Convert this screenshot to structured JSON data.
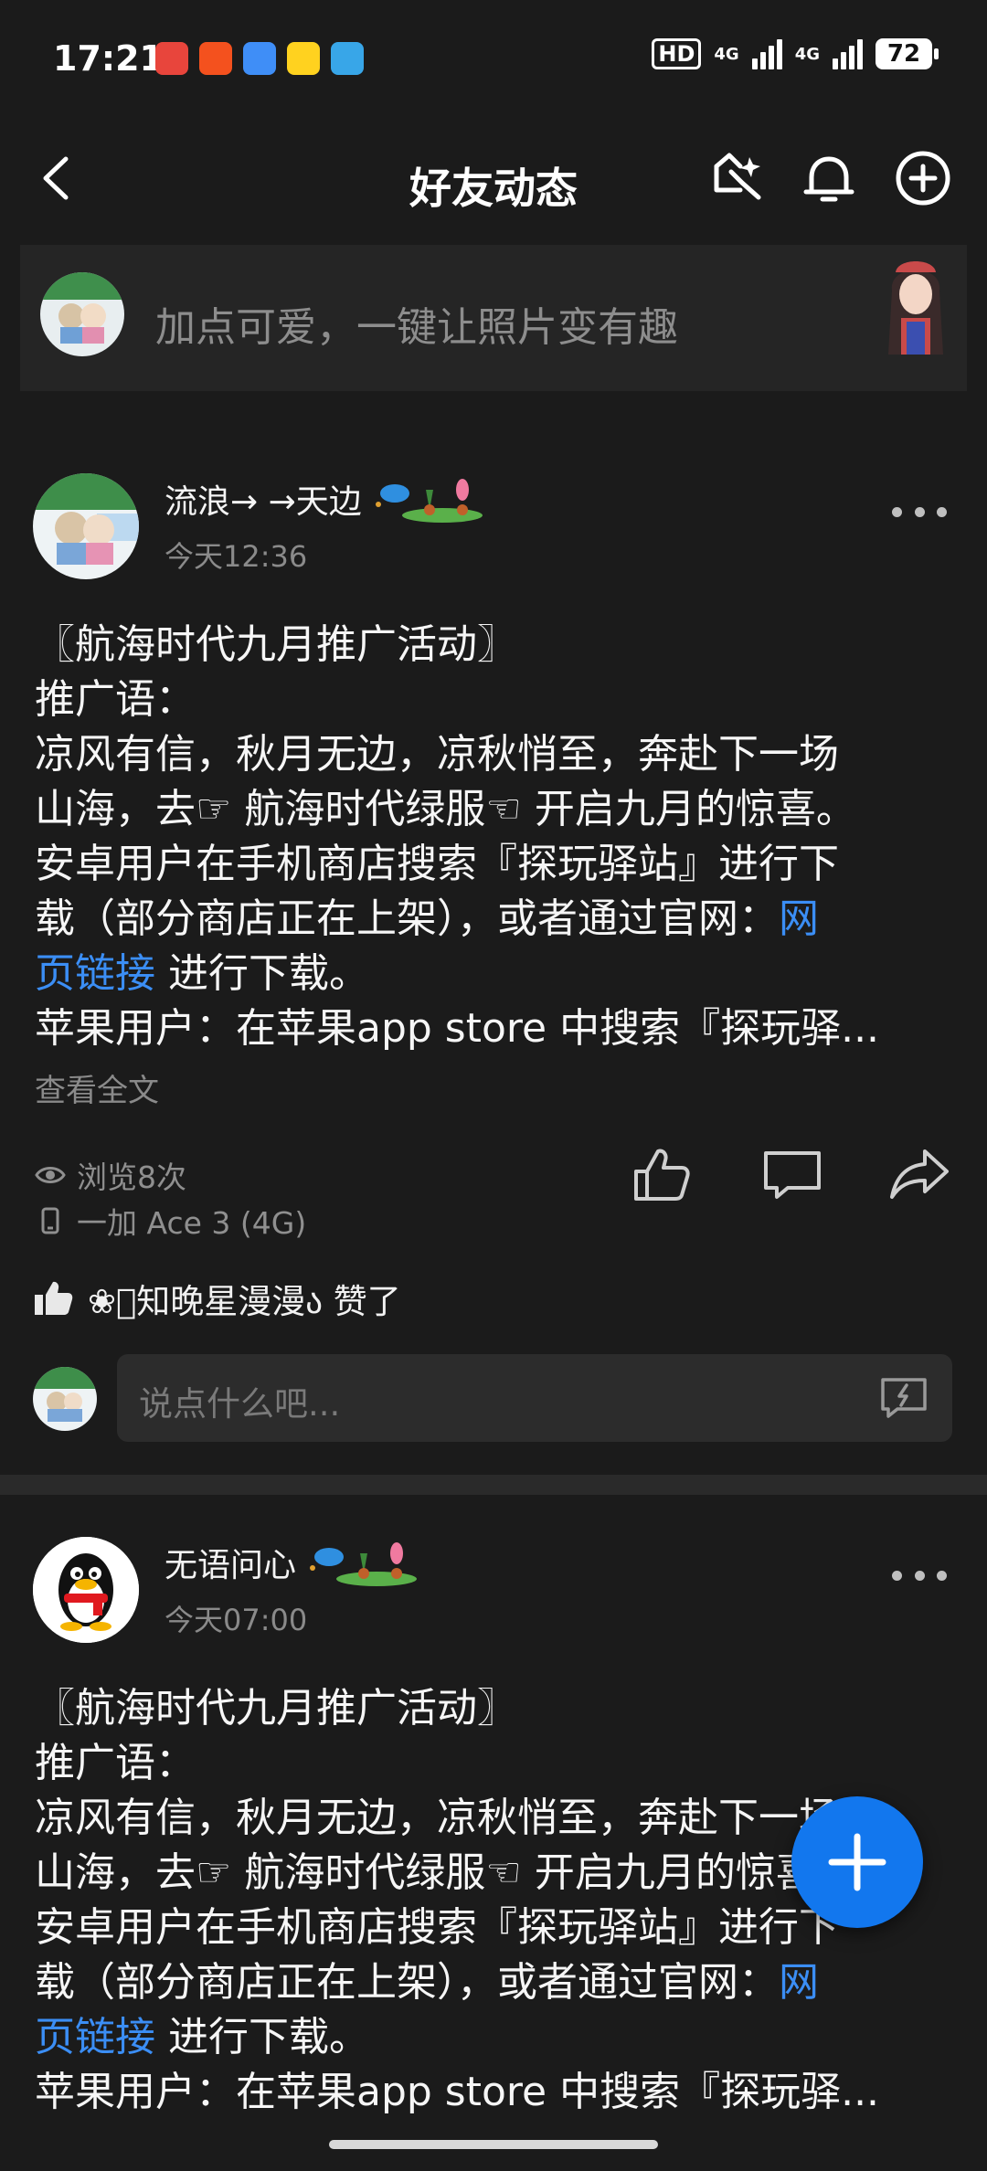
{
  "status_bar": {
    "time": "17:21",
    "hd_label": "HD",
    "net1": "4G",
    "net2": "4G",
    "battery": "72"
  },
  "navbar": {
    "title": "好友动态"
  },
  "promo": {
    "text": "加点可爱，一键让照片变有趣"
  },
  "posts": [
    {
      "name": "流浪→ →天边",
      "time": "今天12:36",
      "body_lines": [
        "〖航海时代九月推广活动〗",
        "推广语：",
        "凉风有信，秋月无边，凉秋悄至，奔赴下一场",
        "山海，去☞ 航海时代绿服☜ 开启九月的惊喜。",
        "安卓用户在手机商店搜索『探玩驿站』进行下",
        "载（部分商店正在上架），或者通过官网：",
        "网",
        "页链接",
        " 进行下载。",
        "苹果用户：在苹果app store 中搜索『探玩驿..."
      ],
      "full_text_label": "查看全文",
      "views": "浏览8次",
      "device": "一加 Ace 3 (4G)",
      "liked_by": "❀ུ知晚星漫漫ა 赞了",
      "comment_placeholder": "说点什么吧..."
    },
    {
      "name": "无语问心",
      "time": "今天07:00",
      "body_lines": [
        "〖航海时代九月推广活动〗",
        "推广语：",
        "凉风有信，秋月无边，凉秋悄至，奔赴下一场",
        "山海，去☞ 航海时代绿服☜ 开启九月的惊喜。",
        "安卓用户在手机商店搜索『探玩驿站』进行下",
        "载（部分商店正在上架），或者通过官网：",
        "网",
        "页链接",
        " 进行下载。",
        "苹果用户：在苹果app store 中搜索『探玩驿..."
      ]
    }
  ],
  "colors": {
    "background": "#1b1b1b",
    "link": "#3b8ef5",
    "fab": "#1277ee"
  }
}
